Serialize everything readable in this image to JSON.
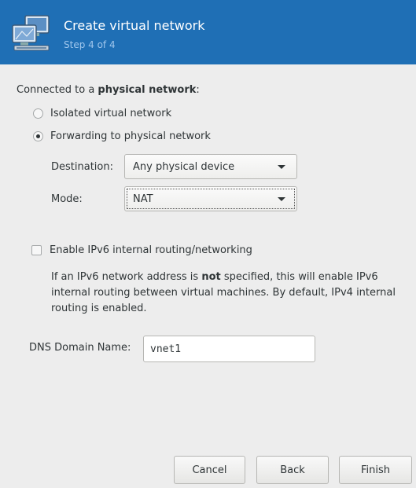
{
  "header": {
    "title": "Create virtual network",
    "step": "Step 4 of 4",
    "icon": "network-computers-icon",
    "background_color": "#1f6fb5"
  },
  "section": {
    "label_prefix": "Connected to a ",
    "label_bold": "physical network",
    "label_suffix": ":"
  },
  "radios": {
    "isolated": {
      "label": "Isolated virtual network",
      "checked": false
    },
    "forwarding": {
      "label": "Forwarding to physical network",
      "checked": true
    }
  },
  "destination": {
    "label": "Destination:",
    "value": "Any physical device"
  },
  "mode": {
    "label": "Mode:",
    "value": "NAT"
  },
  "ipv6": {
    "label": "Enable IPv6 internal routing/networking",
    "checked": false,
    "info_part1": "If an IPv6 network address is ",
    "info_bold": "not",
    "info_part2": " specified, this will enable IPv6 internal routing between virtual machines.  By default, IPv4 internal routing is enabled."
  },
  "dns": {
    "label": "DNS Domain Name:",
    "value": "vnet1"
  },
  "buttons": {
    "cancel": "Cancel",
    "back": "Back",
    "finish": "Finish"
  }
}
